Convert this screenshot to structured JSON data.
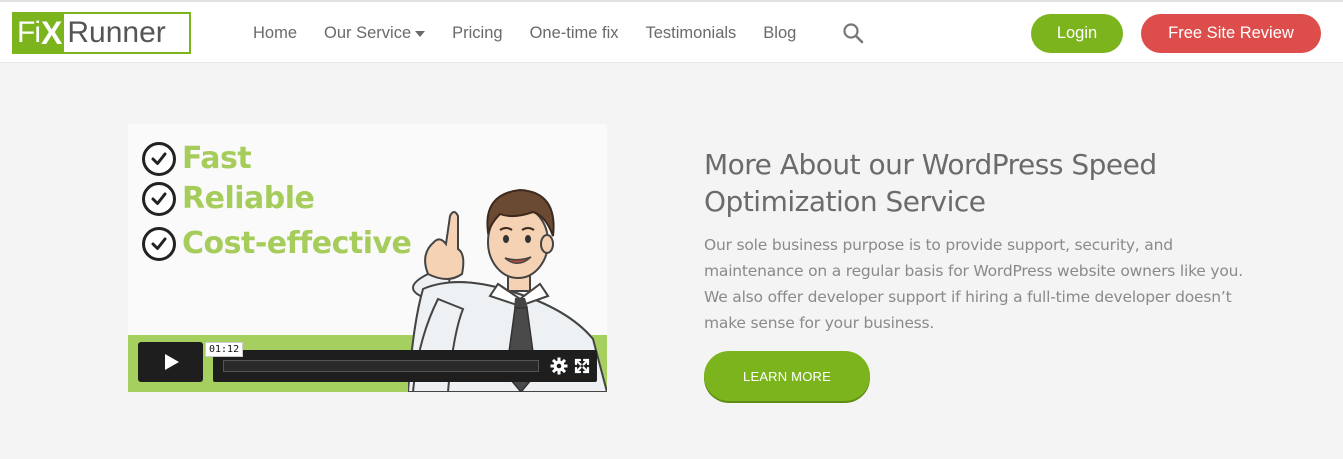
{
  "header": {
    "logo": {
      "part1": "Fi",
      "part2": "X",
      "part3": "Runner"
    },
    "nav": [
      {
        "label": "Home"
      },
      {
        "label": "Our Service",
        "has_dropdown": true
      },
      {
        "label": "Pricing"
      },
      {
        "label": "One-time fix"
      },
      {
        "label": "Testimonials"
      },
      {
        "label": "Blog"
      }
    ],
    "search_icon": "search-icon",
    "login_label": "Login",
    "review_label": "Free Site Review"
  },
  "video": {
    "checklist": [
      "Fast",
      "Reliable",
      "Cost-effective"
    ],
    "timecode": "01:12",
    "icons": [
      "play-icon",
      "gear-icon",
      "fullscreen-icon"
    ]
  },
  "content": {
    "heading": "More About our WordPress Speed Optimization Service",
    "body": "Our sole business purpose is to provide support, security, and maintenance on a regular basis for WordPress website owners like you. We also offer developer support if hiring a full-time developer doesn’t make sense for your business.",
    "cta_label": "LEARN MORE"
  },
  "colors": {
    "brand_green": "#7cb41e",
    "review_red": "#dd4d4b",
    "check_green": "#a6cd5b",
    "page_bg": "#f4f4f4"
  }
}
